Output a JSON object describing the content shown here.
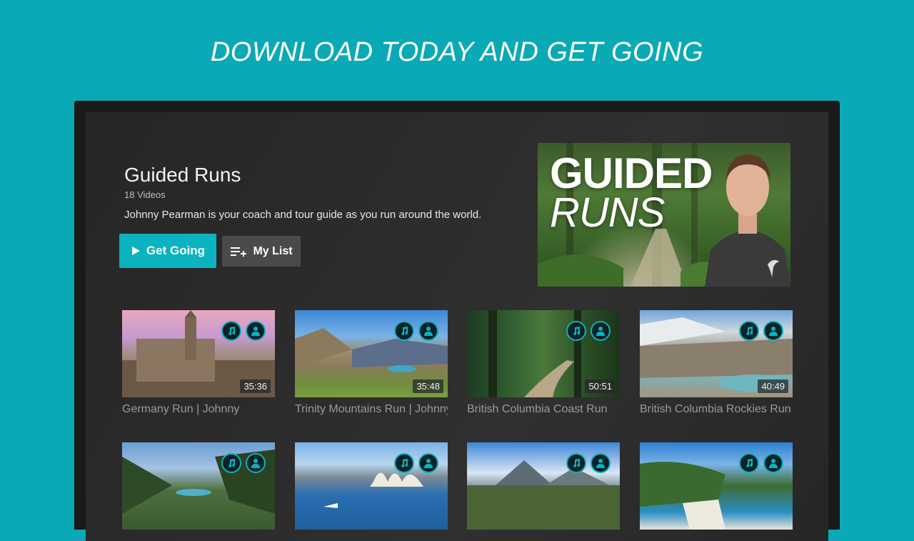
{
  "headline": "DOWNLOAD TODAY AND GET GOING",
  "show": {
    "title": "Guided Runs",
    "count": "18 Videos",
    "description": "Johnny Pearman is your coach and tour guide as you run around the world.",
    "primary_button": "Get Going",
    "secondary_button": "My List"
  },
  "hero": {
    "line1": "GUIDED",
    "line2": "RUNS"
  },
  "videos": [
    {
      "title": "Germany Run | Johnny",
      "duration": "35:36"
    },
    {
      "title": "Trinity Mountains Run | Johnny",
      "duration": "35:48"
    },
    {
      "title": "British Columbia Coast Run",
      "duration": "50:51"
    },
    {
      "title": "British Columbia Rockies Run",
      "duration": "40:49"
    },
    {
      "title": "",
      "duration": ""
    },
    {
      "title": "",
      "duration": ""
    },
    {
      "title": "",
      "duration": ""
    },
    {
      "title": "",
      "duration": ""
    }
  ],
  "colors": {
    "background": "#0aa9b6",
    "accent": "#0bb3c0",
    "screen": "#2b2b2b"
  },
  "icons": [
    "play-icon",
    "add-to-list-icon",
    "music-icon",
    "coach-icon"
  ]
}
